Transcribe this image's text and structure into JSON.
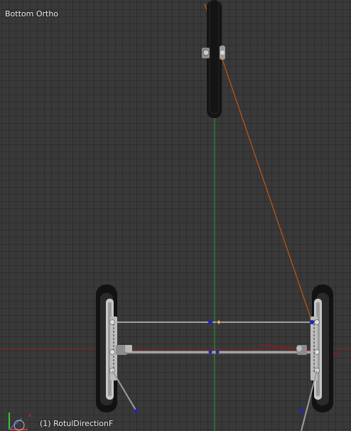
{
  "viewport": {
    "view_name": "Bottom Ortho",
    "active_object_label": "(1) RotulDirectionF",
    "background_color": "#393939",
    "axis_colors": {
      "x": "#8e1c1c",
      "y": "#2f8e2f"
    }
  },
  "scene": {
    "wheel_color": "#161616",
    "frame_color": "#a7a7a7",
    "constraint_line_color": "#c2560f",
    "selected_point_color": "#2323b8"
  },
  "gizmo": {
    "icon": "view-axes-icon",
    "x_color": "#e02b2b",
    "y_color": "#37c437"
  }
}
